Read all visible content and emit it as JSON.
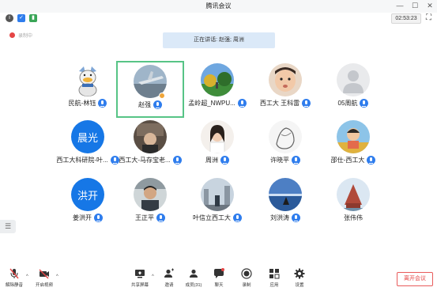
{
  "window": {
    "title": "腾讯会议",
    "controls": [
      "—",
      "☐",
      "✕"
    ]
  },
  "infobar": {
    "timer": "02:53:23"
  },
  "recording": {
    "label": "录制中"
  },
  "speaking": {
    "text": "正在讲话: 赵强; 周洲"
  },
  "participants": [
    {
      "name": "民航-林钰",
      "avatar": "duck",
      "mic": true
    },
    {
      "name": "赵强",
      "avatar": "photo-plane",
      "mic": true,
      "active": true
    },
    {
      "name": "孟岭超_NWPU...",
      "avatar": "photo-park",
      "mic": true
    },
    {
      "name": "西工大 王科雷",
      "avatar": "photo-baby",
      "mic": true
    },
    {
      "name": "05周航",
      "avatar": "default",
      "mic": true
    },
    {
      "name": "西工大科研院-叶...",
      "avatar": "text",
      "avatar_text": "晨光",
      "mic": true
    },
    {
      "name": "西工大-马存宝老...",
      "avatar": "photo-room",
      "mic": true
    },
    {
      "name": "周洲",
      "avatar": "photo-girl",
      "mic": true
    },
    {
      "name": "许晓平",
      "avatar": "photo-sketch",
      "mic": true
    },
    {
      "name": "邵仕-西工大",
      "avatar": "photo-kid",
      "mic": true
    },
    {
      "name": "姜洪开",
      "avatar": "text",
      "avatar_text": "洪开",
      "mic": true
    },
    {
      "name": "王正平",
      "avatar": "photo-man",
      "mic": true
    },
    {
      "name": "叶信立西工大",
      "avatar": "photo-city",
      "mic": true
    },
    {
      "name": "刘洪涛",
      "avatar": "photo-sea",
      "mic": true
    },
    {
      "name": "张伟伟",
      "avatar": "photo-tower",
      "mic": false
    }
  ],
  "toolbar": {
    "unmute": "解除静音",
    "start_video": "开启视频",
    "share_screen": "共享屏幕",
    "invite": "邀请",
    "members": "成员(31)",
    "chat": "聊天",
    "record": "录制",
    "apps": "应用",
    "settings": "设置",
    "leave": "离开会议"
  },
  "colors": {
    "accent": "#2f7ded",
    "active_border": "#57c486",
    "leave": "#e54545"
  }
}
